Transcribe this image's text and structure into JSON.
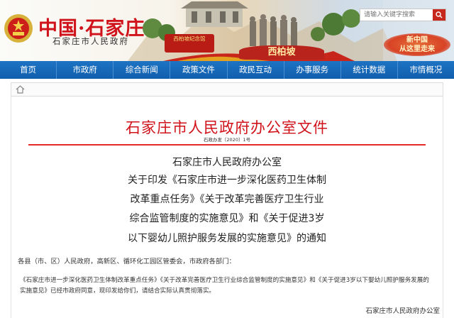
{
  "header": {
    "site_title": "中国·石家庄",
    "site_subtitle": "石家庄市人民政府",
    "search_placeholder": "请输入关键字搜索",
    "banner_sign_left": "西柏坡纪念馆",
    "banner_sign_center": "西柏坡",
    "banner_sign_right": "新中国\n从这里走来"
  },
  "nav": {
    "items": [
      {
        "label": "首页"
      },
      {
        "label": "市政府"
      },
      {
        "label": "综合新闻"
      },
      {
        "label": "政策文件"
      },
      {
        "label": "政民互动"
      },
      {
        "label": "办事服务"
      },
      {
        "label": "统计数据"
      },
      {
        "label": "市情概况"
      }
    ]
  },
  "breadcrumb": {
    "home_icon": "home-icon"
  },
  "document": {
    "head": "石家庄市人民政府办公室文件",
    "number": "石政办发〔2020〕1号",
    "issuer": "石家庄市人民政府办公室",
    "title_lines": [
      "关于印发《石家庄市进一步深化医药卫生体制",
      "改革重点任务》《关于改革完善医疗卫生行业",
      "综合监管制度的实施意见》和《关于促进3岁",
      "以下婴幼儿照护服务发展的实施意见》的通知"
    ],
    "addressees": "各县（市、区）人民政府，高新区、循环化工园区管委会，市政府各部门：",
    "body_line1": "《石家庄市进一步深化医药卫生体制改革重点任务》《关于改革完善医疗卫生行业综合监管制度的实施意见》和《关于促进3岁以下婴幼儿照护服务发展的",
    "body_line2": "实施意见》已经市政府同意，现印发给你们，请结合实际认真贯彻落实。",
    "sign_off": "石家庄市人民政府办公室"
  },
  "colors": {
    "title_red": "#d0131b",
    "nav_blue": "#1668b9",
    "divider_red": "#e32b2b"
  }
}
